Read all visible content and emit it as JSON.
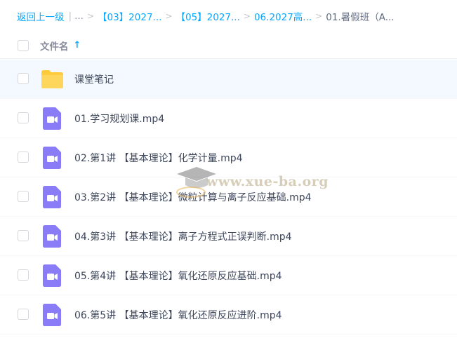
{
  "breadcrumb": {
    "back": "返回上一级",
    "ellipsis": "...",
    "items": [
      "【03】2027...",
      "【05】2027...",
      "06.2027高..."
    ],
    "current": "01.暑假班（A..."
  },
  "header": {
    "column_name": "文件名",
    "sort_icon": "arrow-up-icon"
  },
  "files": [
    {
      "name": "课堂笔记",
      "type": "folder",
      "icon": "folder-icon"
    },
    {
      "name": "01.学习规划课.mp4",
      "type": "video",
      "icon": "video-file-icon"
    },
    {
      "name": "02.第1讲 【基本理论】化学计量.mp4",
      "type": "video",
      "icon": "video-file-icon"
    },
    {
      "name": "03.第2讲 【基本理论】微粒计算与离子反应基础.mp4",
      "type": "video",
      "icon": "video-file-icon"
    },
    {
      "name": "04.第3讲 【基本理论】离子方程式正误判断.mp4",
      "type": "video",
      "icon": "video-file-icon"
    },
    {
      "name": "05.第4讲 【基本理论】氧化还原反应基础.mp4",
      "type": "video",
      "icon": "video-file-icon"
    },
    {
      "name": "06.第5讲 【基本理论】氧化还原反应进阶.mp4",
      "type": "video",
      "icon": "video-file-icon"
    }
  ],
  "watermark": {
    "text": "www.xue-ba.org"
  },
  "colors": {
    "accent": "#06a7ff",
    "folder": "#ffcb3d",
    "video": "#8a7cf6",
    "selected_row": "#f3f9fe"
  }
}
